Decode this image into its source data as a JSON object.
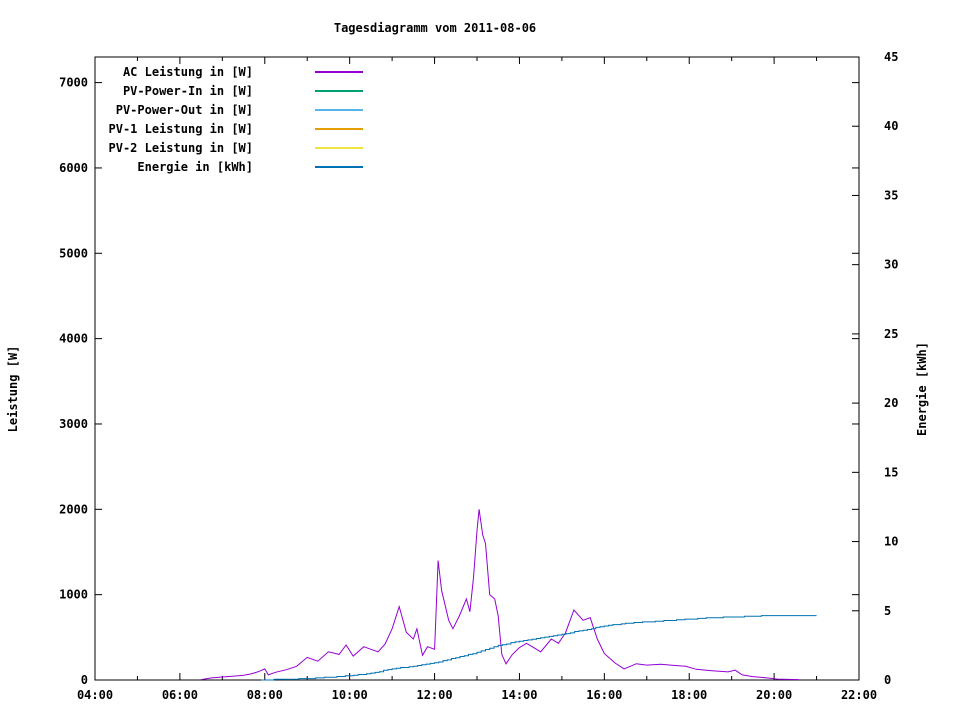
{
  "title": "Tagesdiagramm vom 2011-08-06",
  "colors": {
    "background": "#ffffff",
    "axis": "#000000",
    "ac_power": "#9400d3",
    "pv_power_in": "#009e73",
    "pv_power_out": "#56b4e9",
    "pv1_power": "#e69f00",
    "pv2_power": "#f0e442",
    "energy": "#0072b2"
  },
  "chart_data": {
    "type": "line",
    "title": "Tagesdiagramm vom 2011-08-06",
    "xlabel": "",
    "ylabel": "Leistung [W]",
    "y2label": "Energie [kWh]",
    "xlim": [
      4,
      22
    ],
    "x_tick_labels": [
      "04:00",
      "06:00",
      "08:00",
      "10:00",
      "12:00",
      "14:00",
      "16:00",
      "18:00",
      "20:00",
      "22:00"
    ],
    "x_major_ticks": [
      4,
      6,
      8,
      10,
      12,
      14,
      16,
      18,
      20,
      22
    ],
    "x_minor_ticks": [
      5,
      7,
      9,
      11,
      13,
      15,
      17,
      19,
      21
    ],
    "ylim": [
      0,
      7300
    ],
    "yticks": [
      0,
      1000,
      2000,
      3000,
      4000,
      5000,
      6000,
      7000
    ],
    "y2lim": [
      0,
      45
    ],
    "y2ticks": [
      0,
      5,
      10,
      15,
      20,
      25,
      30,
      35,
      40,
      45
    ],
    "grid": false,
    "legend_position": "top-left",
    "series": [
      {
        "name": "AC Leistung in [W]",
        "color": "#9400d3",
        "axis": "y1",
        "render": "line",
        "points": [
          [
            "06:30",
            5
          ],
          [
            "06:45",
            25
          ],
          [
            "07:00",
            35
          ],
          [
            "07:15",
            45
          ],
          [
            "07:30",
            55
          ],
          [
            "07:40",
            70
          ],
          [
            "07:50",
            95
          ],
          [
            "08:00",
            130
          ],
          [
            "08:05",
            60
          ],
          [
            "08:15",
            90
          ],
          [
            "08:30",
            120
          ],
          [
            "08:45",
            160
          ],
          [
            "09:00",
            265
          ],
          [
            "09:15",
            220
          ],
          [
            "09:30",
            330
          ],
          [
            "09:45",
            300
          ],
          [
            "09:55",
            410
          ],
          [
            "10:05",
            280
          ],
          [
            "10:20",
            390
          ],
          [
            "10:30",
            360
          ],
          [
            "10:40",
            330
          ],
          [
            "10:50",
            420
          ],
          [
            "11:00",
            600
          ],
          [
            "11:10",
            860
          ],
          [
            "11:20",
            560
          ],
          [
            "11:30",
            480
          ],
          [
            "11:35",
            600
          ],
          [
            "11:43",
            290
          ],
          [
            "11:50",
            390
          ],
          [
            "12:00",
            360
          ],
          [
            "12:05",
            1400
          ],
          [
            "12:10",
            1050
          ],
          [
            "12:20",
            700
          ],
          [
            "12:26",
            600
          ],
          [
            "12:35",
            750
          ],
          [
            "12:45",
            950
          ],
          [
            "12:50",
            800
          ],
          [
            "12:55",
            1200
          ],
          [
            "13:00",
            1750
          ],
          [
            "13:03",
            2000
          ],
          [
            "13:08",
            1700
          ],
          [
            "13:12",
            1600
          ],
          [
            "13:18",
            1000
          ],
          [
            "13:25",
            950
          ],
          [
            "13:30",
            750
          ],
          [
            "13:35",
            300
          ],
          [
            "13:41",
            190
          ],
          [
            "13:50",
            300
          ],
          [
            "14:00",
            380
          ],
          [
            "14:10",
            430
          ],
          [
            "14:20",
            380
          ],
          [
            "14:30",
            330
          ],
          [
            "14:45",
            480
          ],
          [
            "14:55",
            430
          ],
          [
            "15:05",
            550
          ],
          [
            "15:17",
            820
          ],
          [
            "15:30",
            700
          ],
          [
            "15:40",
            730
          ],
          [
            "15:50",
            480
          ],
          [
            "16:00",
            310
          ],
          [
            "16:15",
            200
          ],
          [
            "16:28",
            130
          ],
          [
            "16:45",
            190
          ],
          [
            "17:00",
            175
          ],
          [
            "17:20",
            185
          ],
          [
            "17:40",
            170
          ],
          [
            "17:55",
            160
          ],
          [
            "18:10",
            125
          ],
          [
            "18:30",
            110
          ],
          [
            "18:55",
            95
          ],
          [
            "19:05",
            115
          ],
          [
            "19:15",
            60
          ],
          [
            "19:30",
            40
          ],
          [
            "19:50",
            25
          ],
          [
            "20:05",
            10
          ],
          [
            "20:35",
            5
          ]
        ]
      },
      {
        "name": "PV-Power-In in [W]",
        "color": "#009e73",
        "axis": "y1",
        "render": "line",
        "points": []
      },
      {
        "name": "PV-Power-Out in [W]",
        "color": "#56b4e9",
        "axis": "y1",
        "render": "line",
        "points": []
      },
      {
        "name": "PV-1 Leistung in [W]",
        "color": "#e69f00",
        "axis": "y1",
        "render": "line",
        "points": []
      },
      {
        "name": "PV-2 Leistung in [W]",
        "color": "#f0e442",
        "axis": "y1",
        "render": "line",
        "points": []
      },
      {
        "name": "Energie in [kWh]",
        "color": "#0072b2",
        "axis": "y2",
        "render": "steps",
        "points": [
          [
            "07:55",
            0.0
          ],
          [
            "08:30",
            0.05
          ],
          [
            "09:00",
            0.1
          ],
          [
            "09:30",
            0.2
          ],
          [
            "10:00",
            0.3
          ],
          [
            "10:30",
            0.5
          ],
          [
            "11:00",
            0.8
          ],
          [
            "11:30",
            1.0
          ],
          [
            "12:00",
            1.25
          ],
          [
            "12:30",
            1.6
          ],
          [
            "13:00",
            2.0
          ],
          [
            "13:30",
            2.5
          ],
          [
            "14:00",
            2.8
          ],
          [
            "14:30",
            3.05
          ],
          [
            "15:00",
            3.3
          ],
          [
            "15:30",
            3.6
          ],
          [
            "16:00",
            3.9
          ],
          [
            "16:30",
            4.1
          ],
          [
            "17:00",
            4.2
          ],
          [
            "17:30",
            4.3
          ],
          [
            "18:00",
            4.4
          ],
          [
            "18:30",
            4.5
          ],
          [
            "19:00",
            4.55
          ],
          [
            "19:30",
            4.6
          ],
          [
            "19:50",
            4.65
          ],
          [
            "21:00",
            4.65
          ]
        ]
      }
    ]
  }
}
